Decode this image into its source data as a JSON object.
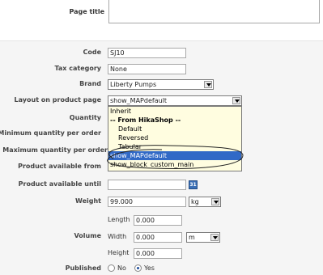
{
  "page_title": {
    "label": "Page title",
    "value": ""
  },
  "code": {
    "label": "Code",
    "value": "SJ10"
  },
  "tax_category": {
    "label": "Tax category",
    "value": "None"
  },
  "brand": {
    "label": "Brand",
    "value": "Liberty Pumps"
  },
  "layout": {
    "label": "Layout on product page",
    "value": "show_MAPdefault",
    "options": [
      {
        "text": "Inherit",
        "kind": "plain"
      },
      {
        "text": "-- From HikaShop --",
        "kind": "group"
      },
      {
        "text": "Default",
        "kind": "sub"
      },
      {
        "text": "Reversed",
        "kind": "sub"
      },
      {
        "text": "Tabular",
        "kind": "sub"
      },
      {
        "text": "show_MAPdefault",
        "kind": "selected"
      },
      {
        "text": "show_block_custom_main",
        "kind": "plain"
      }
    ]
  },
  "quantity": {
    "label": "Quantity"
  },
  "min_qty": {
    "label": "Minimum quantity per order"
  },
  "max_qty": {
    "label": "Maximum quantity per order"
  },
  "available_from": {
    "label": "Product available from"
  },
  "available_until": {
    "label": "Product available until",
    "value": ""
  },
  "weight": {
    "label": "Weight",
    "value": "99.000",
    "unit": "kg"
  },
  "volume": {
    "label": "Volume",
    "length_label": "Length",
    "length": "0.000",
    "width_label": "Width",
    "width": "0.000",
    "height_label": "Height",
    "height": "0.000",
    "unit": "m"
  },
  "published": {
    "label": "Published",
    "no": "No",
    "yes": "Yes",
    "value": "Yes"
  },
  "icons": {
    "calendar": "calendar-icon",
    "dropdown": "chevron-down-icon"
  }
}
